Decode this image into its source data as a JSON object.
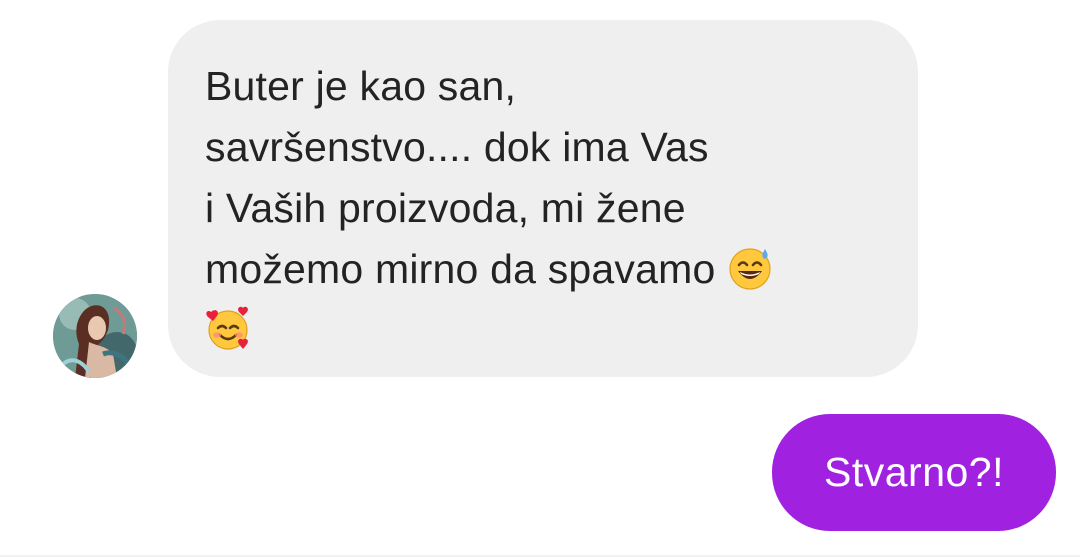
{
  "conversation": {
    "incoming": {
      "lines": [
        "Buter je kao san,",
        "savršenstvo.... dok ima Vas",
        "i Vaših proizvoda, mi žene",
        "možemo mirno da spavamo"
      ],
      "emojis": [
        "grinning-face-with-sweat-icon",
        "smiling-face-with-hearts-icon"
      ],
      "bubble_color": "#efefef",
      "text_color": "#232323"
    },
    "outgoing": {
      "text": "Stvarno?!",
      "bubble_color": "#a021e0",
      "text_color": "#ffffff"
    }
  }
}
